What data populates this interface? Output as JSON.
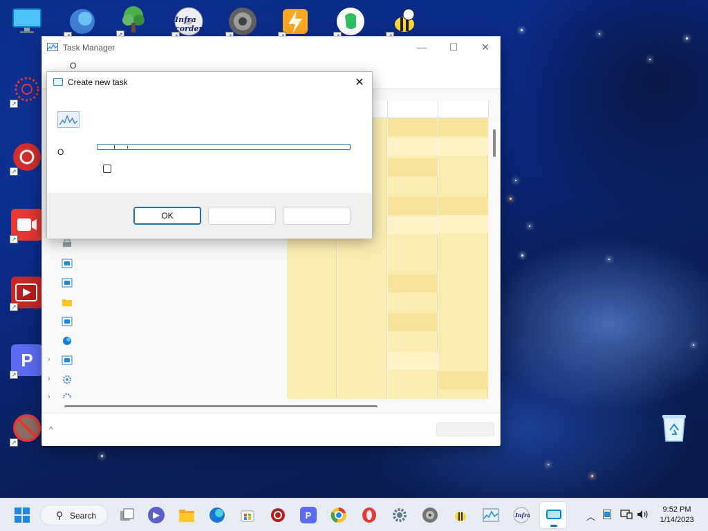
{
  "task_manager": {
    "title": "Task Manager",
    "menu_label": "O",
    "minimize_glyph": "—",
    "maximize_glyph": "☐",
    "close_glyph": "✕",
    "footer_expand_glyph": "^"
  },
  "dialog": {
    "title": "Create new task",
    "close_glyph": "✕",
    "open_label": "O",
    "input_value": "",
    "ok_label": "OK",
    "second_button_label": "",
    "third_button_label": ""
  },
  "taskbar": {
    "search_label": "Search",
    "search_glyph": "⚲",
    "clock_time": "9:52 PM",
    "clock_date": "1/14/2023"
  },
  "desktop_icons": [
    {
      "name": "this-pc-icon",
      "label": ""
    },
    {
      "name": "edge-shortcut-icon",
      "label": ""
    },
    {
      "name": "tree-shortcut-icon",
      "label": ""
    },
    {
      "name": "infra-recorder-icon",
      "label": "Infra corder"
    },
    {
      "name": "disc-icon",
      "label": ""
    },
    {
      "name": "winamp-icon",
      "label": ""
    },
    {
      "name": "evernote-icon",
      "label": ""
    },
    {
      "name": "bee-icon",
      "label": ""
    }
  ],
  "colors": {
    "accent": "#1e6fa8",
    "grid_fill": "#fbedb2",
    "taskbar": "#e8edf4"
  }
}
